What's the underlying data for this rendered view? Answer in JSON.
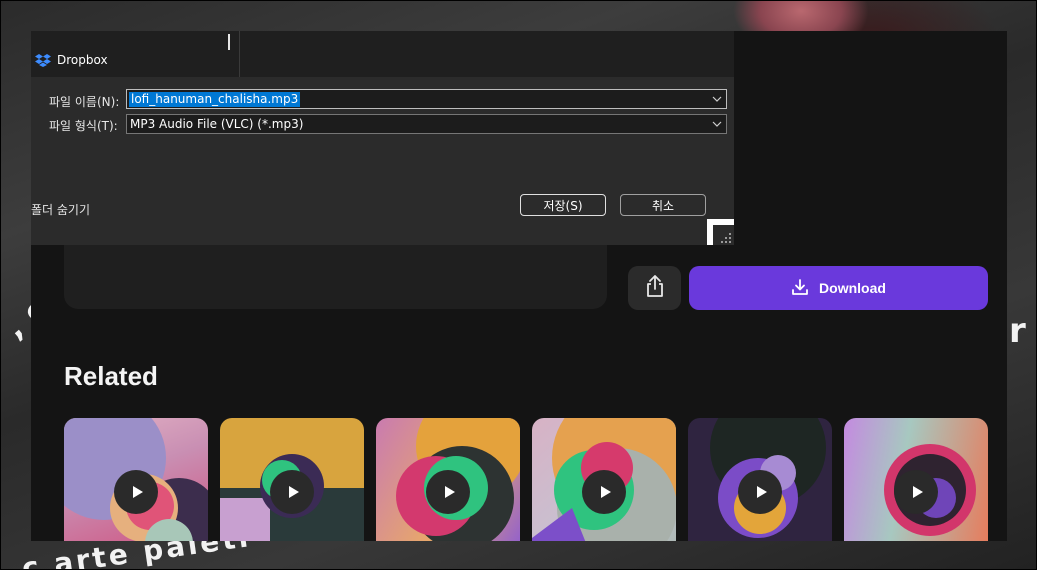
{
  "background": {
    "photo_text_1": ", c",
    "photo_text_2": "r",
    "photo_text_3": "c arte paleti"
  },
  "page": {
    "download_label": "Download",
    "share_icon": "share-icon",
    "download_icon": "download-icon",
    "related_title": "Related",
    "accent_color": "#6a39dc",
    "thumbnails": [
      {
        "name": "related-track-1"
      },
      {
        "name": "related-track-2"
      },
      {
        "name": "related-track-3"
      },
      {
        "name": "related-track-4"
      },
      {
        "name": "related-track-5"
      },
      {
        "name": "related-track-6"
      }
    ]
  },
  "dialog": {
    "nav_item": "Dropbox",
    "filename_label": "파일 이름(N):",
    "filename_value": "lofi_hanuman_chalisha.mp3",
    "filetype_label": "파일 형식(T):",
    "filetype_value": "MP3 Audio File (VLC) (*.mp3)",
    "hide_folders": "폴더 숨기기",
    "save_label": "저장(S)",
    "cancel_label": "취소",
    "selection_color": "#0078d4"
  }
}
